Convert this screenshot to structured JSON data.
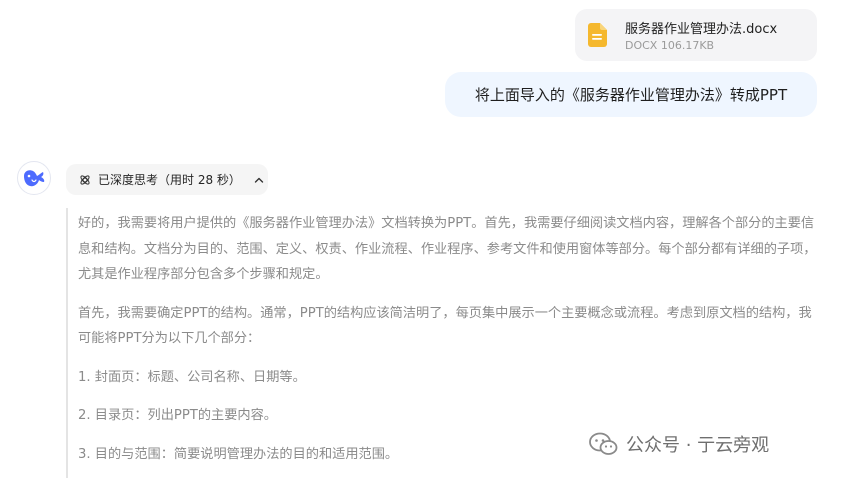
{
  "attachment": {
    "filename": "服务器作业管理办法.docx",
    "meta": "DOCX 106.17KB",
    "icon": "document-icon",
    "icon_color": "#f5b82e"
  },
  "user_message": "将上面导入的《服务器作业管理办法》转成PPT",
  "assistant": {
    "avatar_icon": "whale-logo-icon",
    "think_toggle_label": "已深度思考（用时 28 秒）",
    "thought_paragraphs": [
      "好的，我需要将用户提供的《服务器作业管理办法》文档转换为PPT。首先，我需要仔细阅读文档内容，理解各个部分的主要信息和结构。文档分为目的、范围、定义、权责、作业流程、作业程序、参考文件和使用窗体等部分。每个部分都有详细的子项，尤其是作业程序部分包含多个步骤和规定。",
      "首先，我需要确定PPT的结构。通常，PPT的结构应该简洁明了，每页集中展示一个主要概念或流程。考虑到原文档的结构，我可能将PPT分为以下几个部分：",
      "1. 封面页：标题、公司名称、日期等。",
      "2. 目录页：列出PPT的主要内容。",
      "3. 目的与范围：简要说明管理办法的目的和适用范围。"
    ]
  },
  "watermark": {
    "text": "公众号 · 亍云旁观",
    "icon": "wechat-icon"
  },
  "colors": {
    "user_bubble_bg": "#eff6ff",
    "file_card_bg": "#f4f4f6",
    "brand_blue": "#4d6bfe",
    "thought_text": "#8b8b8b"
  }
}
